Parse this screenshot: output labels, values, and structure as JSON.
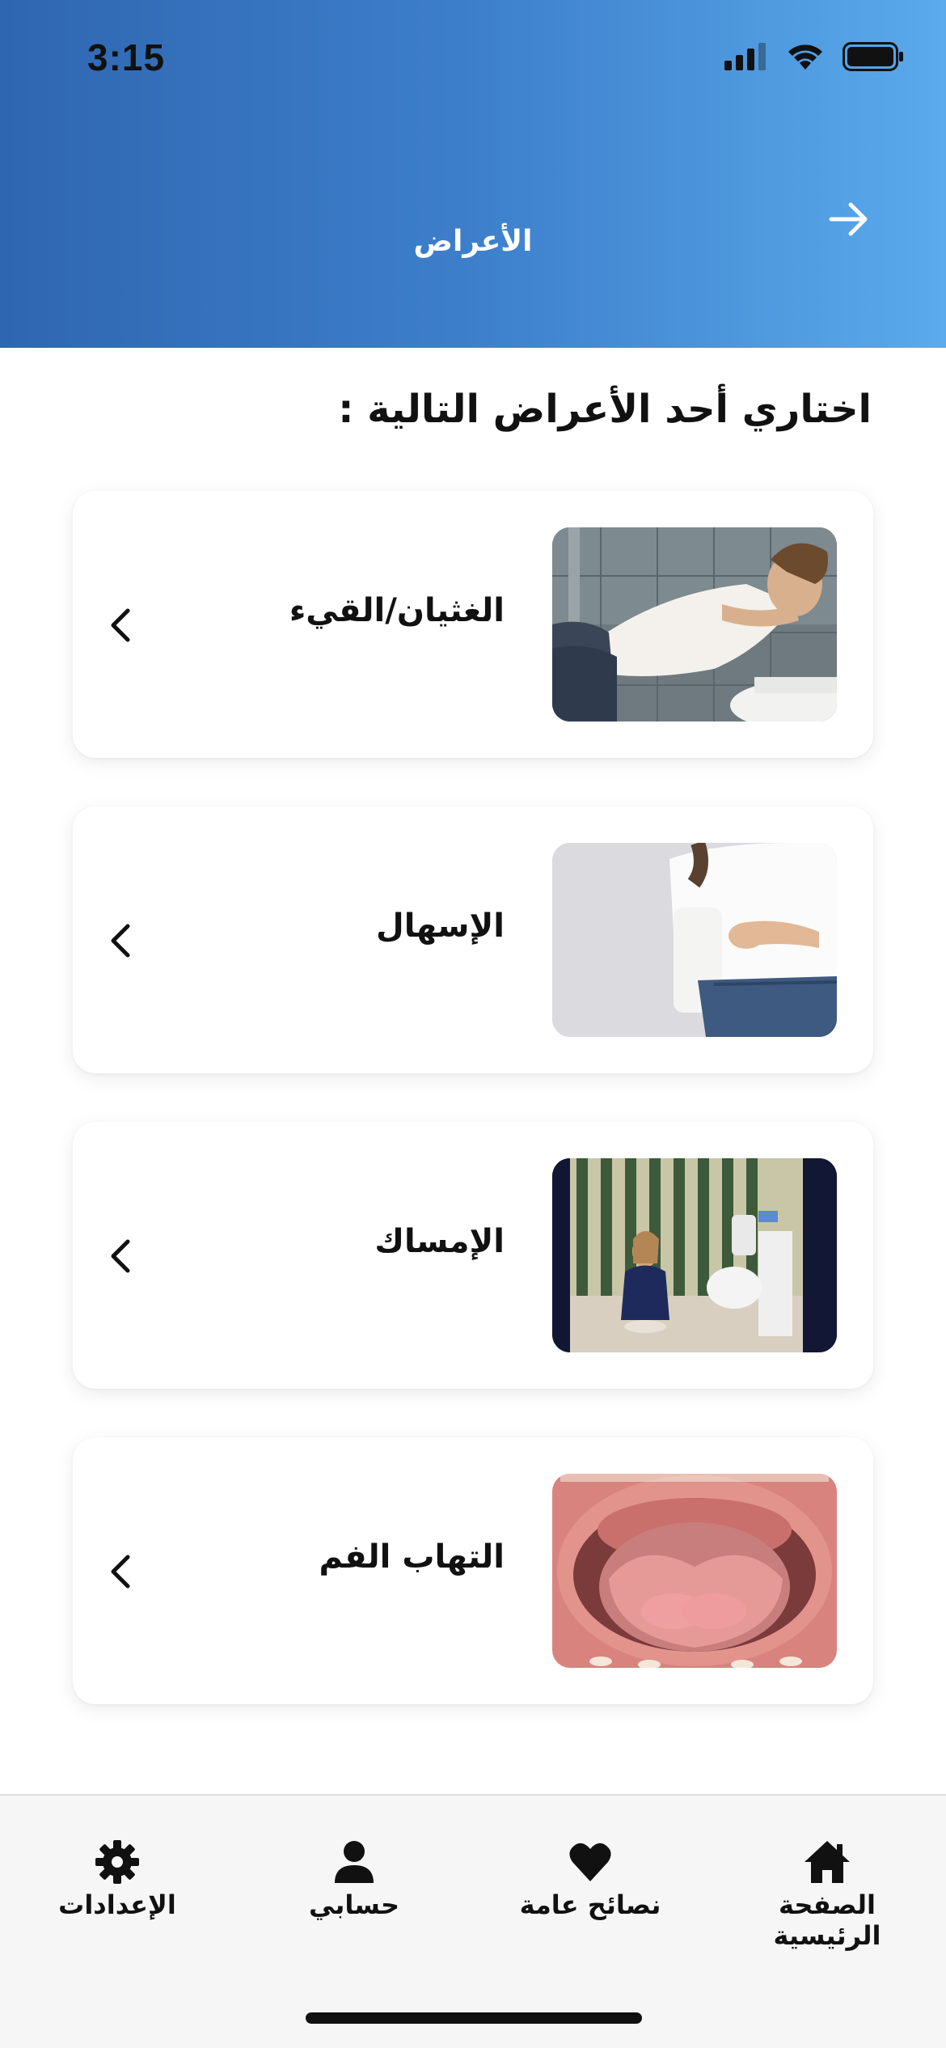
{
  "status_bar": {
    "time": "3:15"
  },
  "header": {
    "title": "الأعراض",
    "back_icon": "arrow-right-icon"
  },
  "prompt": "اختاري أحد الأعراض التالية :",
  "symptoms": [
    {
      "label": "الغثيان/القيء",
      "image": "nausea-photo"
    },
    {
      "label": "الإسهال",
      "image": "diarrhea-photo"
    },
    {
      "label": "الإمساك",
      "image": "constipation-photo"
    },
    {
      "label": "التهاب الفم",
      "image": "mouth-inflammation-photo"
    }
  ],
  "tabbar": {
    "items": [
      {
        "label": "الإعدادات",
        "icon": "gear-icon"
      },
      {
        "label": "حسابي",
        "icon": "user-icon"
      },
      {
        "label": "نصائح عامة",
        "icon": "heart-icon"
      },
      {
        "label": "الصفحة الرئيسية",
        "icon": "home-icon"
      }
    ]
  },
  "colors": {
    "header_gradient_start": "#2f66b1",
    "header_gradient_end": "#5aaaec",
    "tabbar_bg": "#f6f6f6"
  }
}
